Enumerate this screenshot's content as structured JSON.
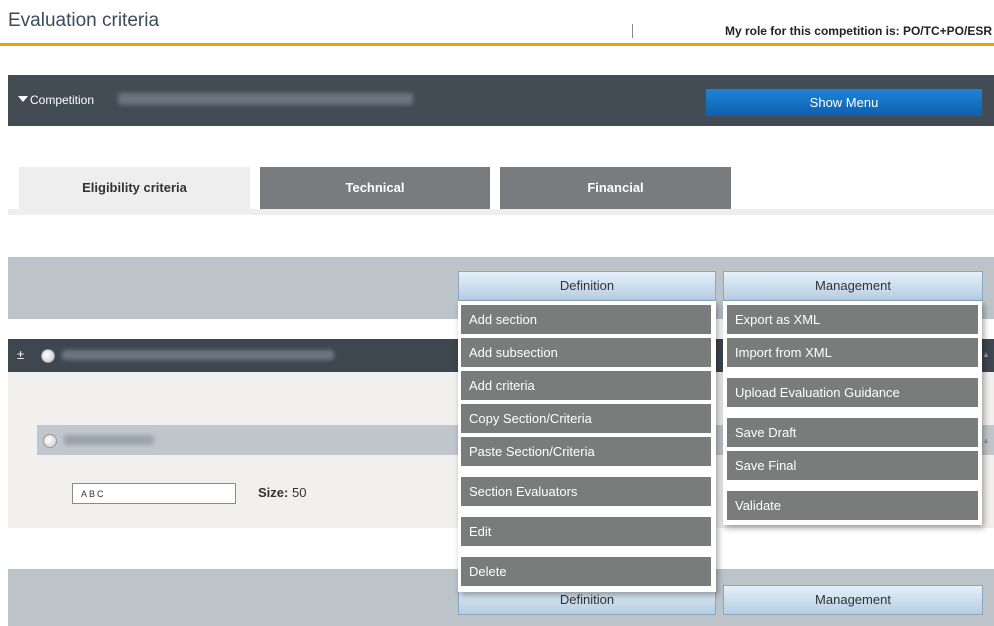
{
  "page": {
    "title": "Evaluation criteria",
    "role_text": "My role for this competition is: PO/TC+PO/ESR"
  },
  "competition": {
    "label": "Competition",
    "show_menu": "Show Menu"
  },
  "tabs": [
    {
      "label": "Eligibility criteria",
      "active": true
    },
    {
      "label": "Technical",
      "active": false
    },
    {
      "label": "Financial",
      "active": false
    }
  ],
  "toolbar": {
    "definition_label": "Definition",
    "management_label": "Management"
  },
  "section": {
    "expand_symbol": "±"
  },
  "criteria": {
    "input_value": "ABC",
    "size_label": "Size:",
    "size_value": "50"
  },
  "definition_menu": {
    "items": [
      "Add section",
      "Add subsection",
      "Add criteria",
      "Copy Section/Criteria",
      "Paste Section/Criteria",
      "Section Evaluators",
      "Edit",
      "Delete"
    ]
  },
  "management_menu": {
    "items": [
      "Export as XML",
      "Import from XML",
      "Upload Evaluation Guidance",
      "Save Draft",
      "Save Final",
      "Validate"
    ]
  },
  "colors": {
    "accent": "#e8a400",
    "show_menu_bg": "#1a78c8",
    "header_bar": "#434b55",
    "menu_item": "#7a7b7b"
  }
}
